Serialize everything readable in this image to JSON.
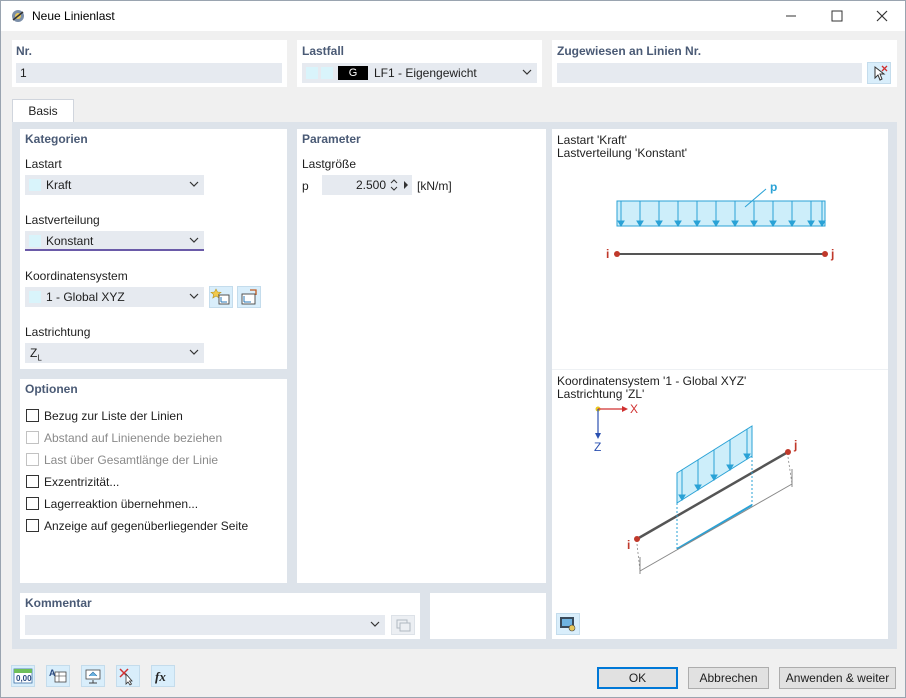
{
  "window": {
    "title": "Neue Linienlast",
    "minimize": "—",
    "maximize": "☐",
    "close": "✕"
  },
  "nr": {
    "label": "Nr.",
    "value": "1"
  },
  "lastfall": {
    "label": "Lastfall",
    "code": "G",
    "value": "LF1 - Eigengewicht"
  },
  "zugewiesen": {
    "label": "Zugewiesen an Linien Nr.",
    "value": ""
  },
  "tabs": [
    {
      "label": "Basis"
    }
  ],
  "kategorien": {
    "heading": "Kategorien",
    "lastart": {
      "label": "Lastart",
      "value": "Kraft"
    },
    "lastverteilung": {
      "label": "Lastverteilung",
      "value": "Konstant"
    },
    "koordinatensystem": {
      "label": "Koordinatensystem",
      "value": "1 - Global XYZ"
    },
    "lastrichtung": {
      "label": "Lastrichtung",
      "value": "Z",
      "subscript": "L"
    }
  },
  "optionen": {
    "heading": "Optionen",
    "items": [
      {
        "label": "Bezug zur Liste der Linien",
        "enabled": true,
        "checked": false
      },
      {
        "label": "Abstand auf Linienende beziehen",
        "enabled": false,
        "checked": false
      },
      {
        "label": "Last über Gesamtlänge der Linie",
        "enabled": false,
        "checked": false
      },
      {
        "label": "Exzentrizität...",
        "enabled": true,
        "checked": false
      },
      {
        "label": "Lagerreaktion übernehmen...",
        "enabled": true,
        "checked": false
      },
      {
        "label": "Anzeige auf gegenüberliegender Seite",
        "enabled": true,
        "checked": false
      }
    ]
  },
  "parameter": {
    "heading": "Parameter",
    "lastgroesse": {
      "label": "Lastgröße",
      "symbol": "p",
      "value": "2.500",
      "unit": "[kN/m]"
    }
  },
  "preview": {
    "top_line1": "Lastart 'Kraft'",
    "top_line2": "Lastverteilung 'Konstant'",
    "load_label": "p",
    "node_i": "i",
    "node_j": "j",
    "bottom_line1": "Koordinatensystem '1 - Global XYZ'",
    "bottom_line2": "Lastrichtung 'ZL'",
    "axis_x": "X",
    "axis_z": "Z"
  },
  "kommentar": {
    "heading": "Kommentar",
    "value": ""
  },
  "buttons": {
    "ok": "OK",
    "cancel": "Abbrechen",
    "apply": "Anwenden & weiter"
  },
  "footer_icons": [
    "units-icon",
    "table-icon",
    "view-icon",
    "delete-icon",
    "formula-icon"
  ],
  "colors": {
    "load_fill": "#cdeefa",
    "load_stroke": "#2aa2d6",
    "node": "#c0392b",
    "member": "#555555",
    "header_text": "#4a5a75"
  }
}
